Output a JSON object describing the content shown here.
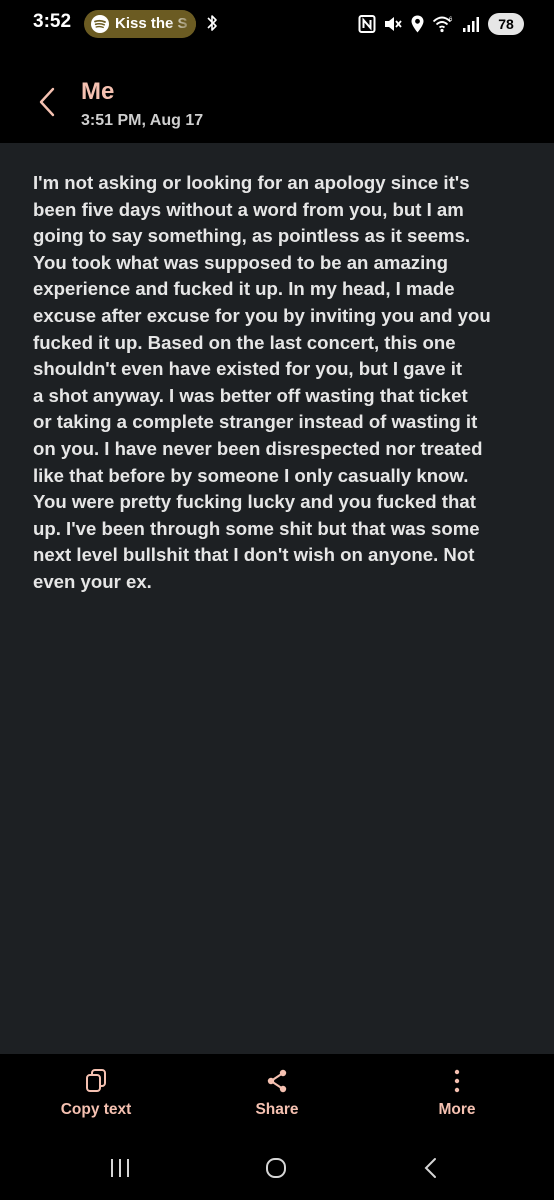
{
  "status_bar": {
    "time": "3:52",
    "now_playing": "Kiss the S",
    "battery": "78"
  },
  "header": {
    "contact": "Me",
    "timestamp": "3:51 PM, Aug 17"
  },
  "message": {
    "body": "I'm not asking or looking for an apology since it's\nbeen five days without a word from you, but I am\ngoing to say something, as pointless as it seems.\nYou took what was supposed to be an amazing\nexperience and fucked it up. In my head, I made\nexcuse after excuse for you by inviting you and you\nfucked it up. Based on the last concert, this one\nshouldn't even have existed for you, but I gave it\na shot anyway. I was better off wasting that ticket\nor taking a complete stranger instead of wasting it\non you. I have never been disrespected nor treated\nlike that before by someone I only casually know.\nYou were pretty fucking lucky and you fucked that\nup. I've been through some shit but that was some\nnext level bullshit that I don't wish on anyone. Not\neven your ex."
  },
  "actions": {
    "copy": "Copy text",
    "share": "Share",
    "more": "More"
  },
  "colors": {
    "accent": "#f5c1b1",
    "message_background": "#1d2023",
    "text": "#e6e6e6"
  },
  "icons": {
    "back": "chevron-left-icon",
    "copy": "copy-icon",
    "share": "share-icon",
    "more": "more-vertical-icon",
    "music": "spotify-icon",
    "bluetooth": "bluetooth-icon",
    "nfc": "nfc-icon",
    "mute": "mute-icon",
    "location": "location-icon",
    "wifi": "wifi-icon",
    "signal": "signal-icon"
  }
}
